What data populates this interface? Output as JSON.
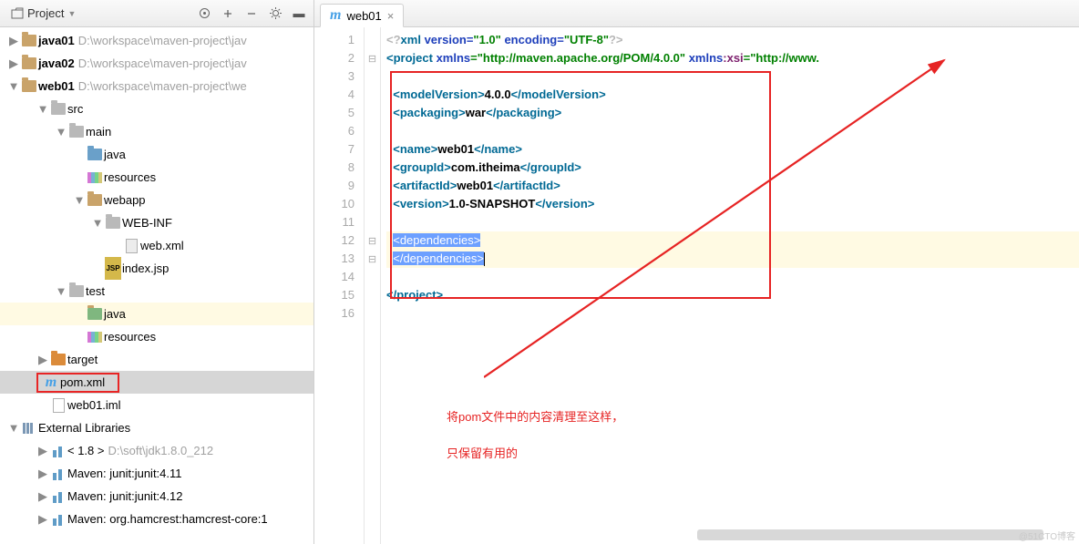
{
  "panel": {
    "title": "Project",
    "modules": [
      {
        "name": "java01",
        "path": "D:\\workspace\\maven-project\\jav"
      },
      {
        "name": "java02",
        "path": "D:\\workspace\\maven-project\\jav"
      }
    ],
    "web01": {
      "name": "web01",
      "path": "D:\\workspace\\maven-project\\we"
    },
    "tree": {
      "src": "src",
      "main": "main",
      "java": "java",
      "resources": "resources",
      "webapp": "webapp",
      "webinf": "WEB-INF",
      "webxml": "web.xml",
      "indexjsp": "index.jsp",
      "test": "test",
      "java2": "java",
      "resources2": "resources",
      "target": "target",
      "pom": "pom.xml",
      "iml": "web01.iml"
    },
    "ext": "External Libraries",
    "libs": [
      {
        "label": "< 1.8 >",
        "hint": "D:\\soft\\jdk1.8.0_212"
      },
      {
        "label": "Maven: junit:junit:4.11"
      },
      {
        "label": "Maven: junit:junit:4.12"
      },
      {
        "label": "Maven: org.hamcrest:hamcrest-core:1"
      }
    ]
  },
  "tab": {
    "label": "web01",
    "file": "pom.xml"
  },
  "code": {
    "xmlDecl": {
      "open": "<?",
      "xml": "xml",
      "verAttr": "version=",
      "verVal": "\"1.0\"",
      "encAttr": "encoding=",
      "encVal": "\"UTF-8\"",
      "close": "?>"
    },
    "project": {
      "open": "<",
      "name": "project",
      "xmlns": "xmlns",
      "xmlnsVal": "=\"http://maven.apache.org/POM/4.0.0\"",
      "xsi": "xmlns:xsi",
      "xsiVal": "=\"http://www."
    },
    "modelVersion": {
      "tag": "modelVersion",
      "val": "4.0.0"
    },
    "packaging": {
      "tag": "packaging",
      "val": "war"
    },
    "nameE": {
      "tag": "name",
      "val": "web01"
    },
    "groupId": {
      "tag": "groupId",
      "val": "com.itheima"
    },
    "artifactId": {
      "tag": "artifactId",
      "val": "web01"
    },
    "version": {
      "tag": "version",
      "val": "1.0-SNAPSHOT"
    },
    "depOpen": "<dependencies>",
    "depClose": "</dependencies>",
    "projectClose": "</project>"
  },
  "annotation": {
    "l1": "将pom文件中的内容清理至这样，",
    "l2": "只保留有用的"
  },
  "lineCount": 16
}
